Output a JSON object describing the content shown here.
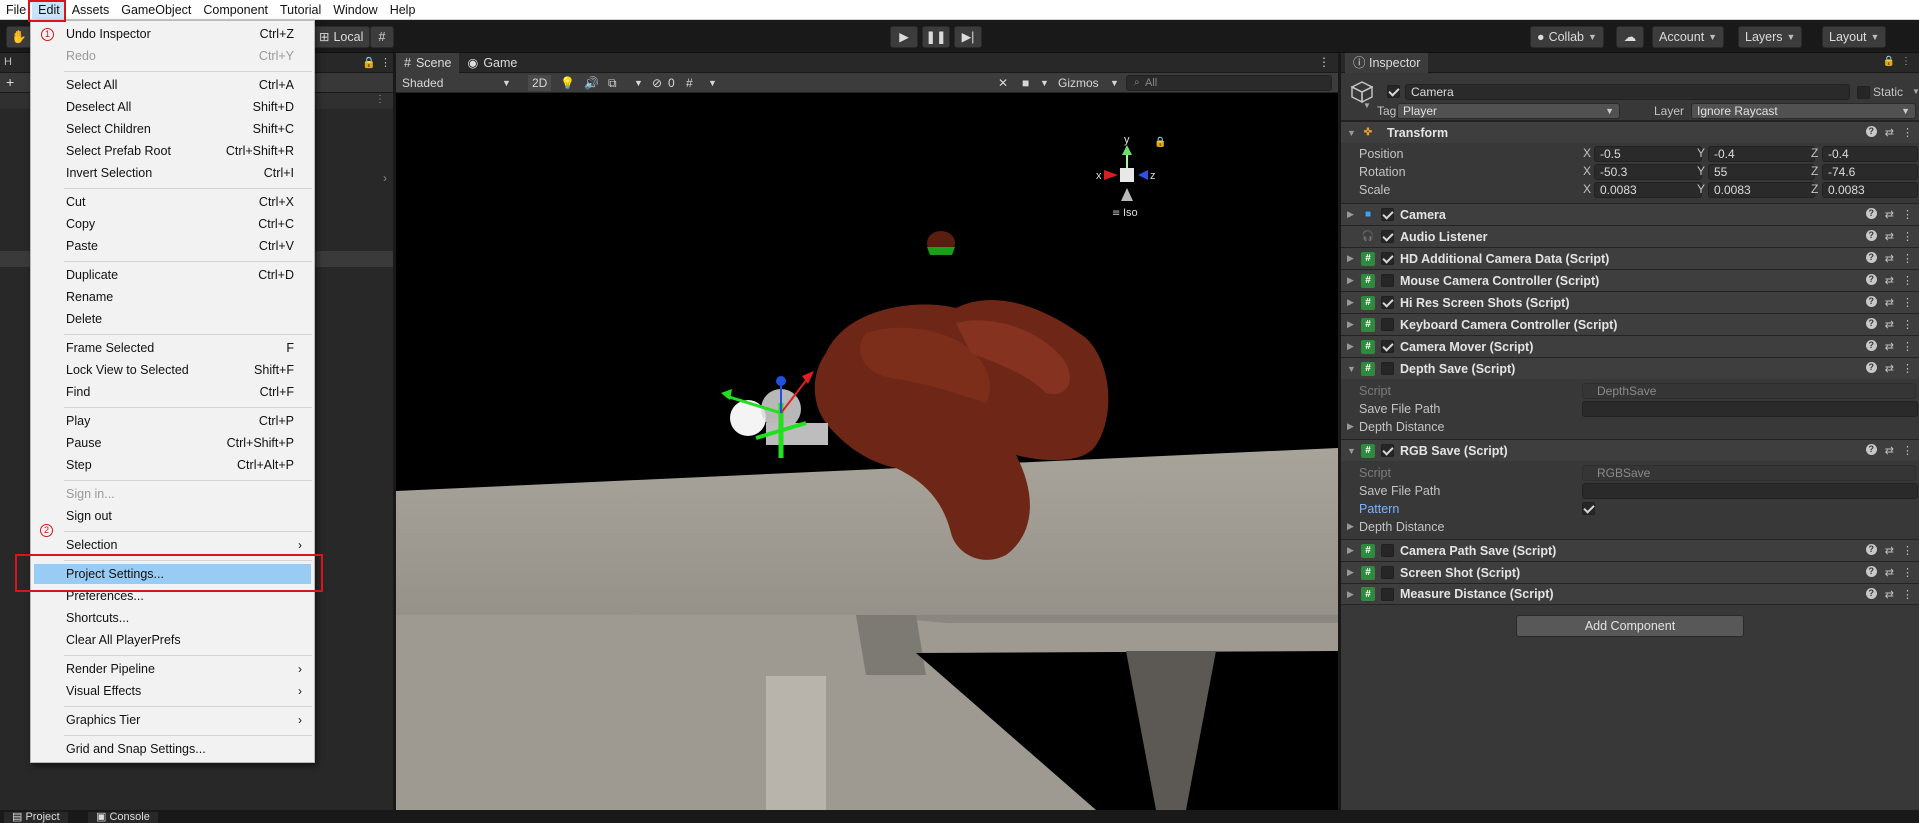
{
  "menubar": [
    "File",
    "Edit",
    "Assets",
    "GameObject",
    "Component",
    "Tutorial",
    "Window",
    "Help"
  ],
  "toolbar": {
    "local_label": "Local",
    "collab_label": "Collab",
    "account_label": "Account",
    "layers_label": "Layers",
    "layout_label": "Layout"
  },
  "left_panel": {
    "tab_label": "H"
  },
  "scene": {
    "tabs": [
      "Scene",
      "Game"
    ],
    "shading": "Shaded",
    "mode_2d": "2D",
    "hidden_count": "0",
    "gizmos_label": "Gizmos",
    "search_placeholder": "All",
    "gizmo_x": "x",
    "gizmo_y": "y",
    "gizmo_z": "z",
    "iso_label": "Iso"
  },
  "edit_menu": {
    "items": [
      {
        "label": "Undo Inspector",
        "shortcut": "Ctrl+Z"
      },
      {
        "label": "Redo",
        "shortcut": "Ctrl+Y"
      },
      {
        "label": "Select All",
        "shortcut": "Ctrl+A"
      },
      {
        "label": "Deselect All",
        "shortcut": "Shift+D"
      },
      {
        "label": "Select Children",
        "shortcut": "Shift+C"
      },
      {
        "label": "Select Prefab Root",
        "shortcut": "Ctrl+Shift+R"
      },
      {
        "label": "Invert Selection",
        "shortcut": "Ctrl+I"
      },
      {
        "label": "Cut",
        "shortcut": "Ctrl+X"
      },
      {
        "label": "Copy",
        "shortcut": "Ctrl+C"
      },
      {
        "label": "Paste",
        "shortcut": "Ctrl+V"
      },
      {
        "label": "Duplicate",
        "shortcut": "Ctrl+D"
      },
      {
        "label": "Rename",
        "shortcut": ""
      },
      {
        "label": "Delete",
        "shortcut": ""
      },
      {
        "label": "Frame Selected",
        "shortcut": "F"
      },
      {
        "label": "Lock View to Selected",
        "shortcut": "Shift+F"
      },
      {
        "label": "Find",
        "shortcut": "Ctrl+F"
      },
      {
        "label": "Play",
        "shortcut": "Ctrl+P"
      },
      {
        "label": "Pause",
        "shortcut": "Ctrl+Shift+P"
      },
      {
        "label": "Step",
        "shortcut": "Ctrl+Alt+P"
      },
      {
        "label": "Sign in...",
        "shortcut": ""
      },
      {
        "label": "Sign out",
        "shortcut": ""
      },
      {
        "label": "Selection",
        "shortcut": ""
      },
      {
        "label": "Project Settings...",
        "shortcut": ""
      },
      {
        "label": "Preferences...",
        "shortcut": ""
      },
      {
        "label": "Shortcuts...",
        "shortcut": ""
      },
      {
        "label": "Clear All PlayerPrefs",
        "shortcut": ""
      },
      {
        "label": "Render Pipeline",
        "shortcut": ""
      },
      {
        "label": "Visual Effects",
        "shortcut": ""
      },
      {
        "label": "Graphics Tier",
        "shortcut": ""
      },
      {
        "label": "Grid and Snap Settings...",
        "shortcut": ""
      }
    ]
  },
  "annotations": {
    "step1": "1",
    "step2": "2"
  },
  "inspector": {
    "tab_label": "Inspector",
    "object_name": "Camera",
    "static_label": "Static",
    "tag_label": "Tag",
    "tag_value": "Player",
    "layer_label": "Layer",
    "layer_value": "Ignore Raycast",
    "transform": {
      "title": "Transform",
      "position_label": "Position",
      "rotation_label": "Rotation",
      "scale_label": "Scale",
      "position": [
        "-0.5",
        "-0.4",
        "-0.4"
      ],
      "rotation": [
        "-50.3",
        "55",
        "-74.6"
      ],
      "scale": [
        "0.0083",
        "0.0083",
        "0.0083"
      ]
    },
    "components": [
      "Camera",
      "Audio Listener",
      "HD Additional Camera Data (Script)",
      "Mouse Camera Controller (Script)",
      "Hi Res Screen Shots (Script)",
      "Keyboard Camera Controller (Script)",
      "Camera Mover (Script)",
      "Depth Save (Script)",
      "RGB Save (Script)",
      "Camera Path Save (Script)",
      "Screen Shot (Script)",
      "Measure Distance (Script)"
    ],
    "depth_save": {
      "script_label": "Script",
      "script_value": "DepthSave",
      "save_path_label": "Save File Path",
      "depth_distance_label": "Depth Distance"
    },
    "rgb_save": {
      "script_label": "Script",
      "script_value": "RGBSave",
      "save_path_label": "Save File Path",
      "pattern_label": "Pattern",
      "depth_distance_label": "Depth Distance"
    },
    "add_component": "Add Component"
  },
  "bottom_tabs": [
    "Project",
    "Console"
  ]
}
